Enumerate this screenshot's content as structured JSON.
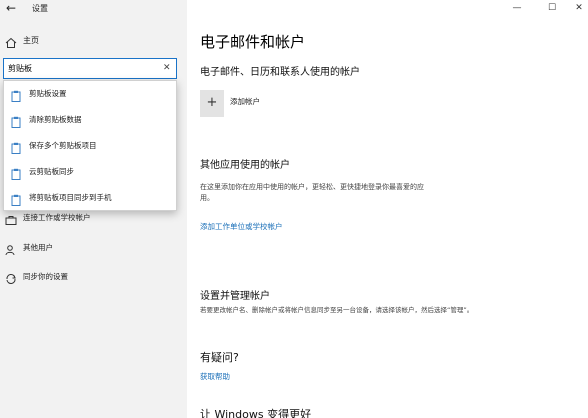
{
  "window": {
    "title": "设置",
    "back_glyph": "←",
    "minimize_glyph": "—",
    "maximize_glyph": "☐",
    "close_glyph": "✕"
  },
  "sidebar": {
    "home_label": "主页",
    "search": {
      "value": "剪贴板",
      "placeholder": "",
      "clear_glyph": "✕"
    },
    "suggestions": [
      {
        "label": "剪贴板设置",
        "icon": "clipboard-icon"
      },
      {
        "label": "清除剪贴板数据",
        "icon": "clipboard-icon"
      },
      {
        "label": "保存多个剪贴板项目",
        "icon": "clipboard-icon"
      },
      {
        "label": "云剪贴板同步",
        "icon": "clipboard-icon"
      },
      {
        "label": "将剪贴板项目同步到手机",
        "icon": "clipboard-icon"
      }
    ],
    "items": [
      {
        "label": "连接工作或学校帐户",
        "icon": "briefcase-icon"
      },
      {
        "label": "其他用户",
        "icon": "person-add-icon"
      },
      {
        "label": "同步你的设置",
        "icon": "sync-icon"
      }
    ]
  },
  "main": {
    "title": "电子邮件和帐户",
    "email_section": {
      "heading": "电子邮件、日历和联系人使用的帐户",
      "add_glyph": "+",
      "add_label": "添加帐户"
    },
    "other_section": {
      "heading": "其他应用使用的帐户",
      "description_line1": "在这里添加你在应用中使用的帐户，更轻松、更快捷地登录你最喜爱的应",
      "description_line2": "用。",
      "link": "添加工作单位或学校帐户"
    },
    "manage_section": {
      "heading": "设置并管理帐户",
      "description": "若要更改帐户名、删除帐户或将帐户信息同步至另一台设备，请选择该帐户，然后选择“管理”。"
    },
    "help_section": {
      "heading": "有疑问?",
      "link": "获取帮助"
    },
    "improve_section": {
      "heading": "让 Windows 变得更好"
    }
  },
  "colors": {
    "sidebar_bg": "#f2f2f2",
    "accent": "#1a73c8",
    "link": "#1a6fb8"
  }
}
